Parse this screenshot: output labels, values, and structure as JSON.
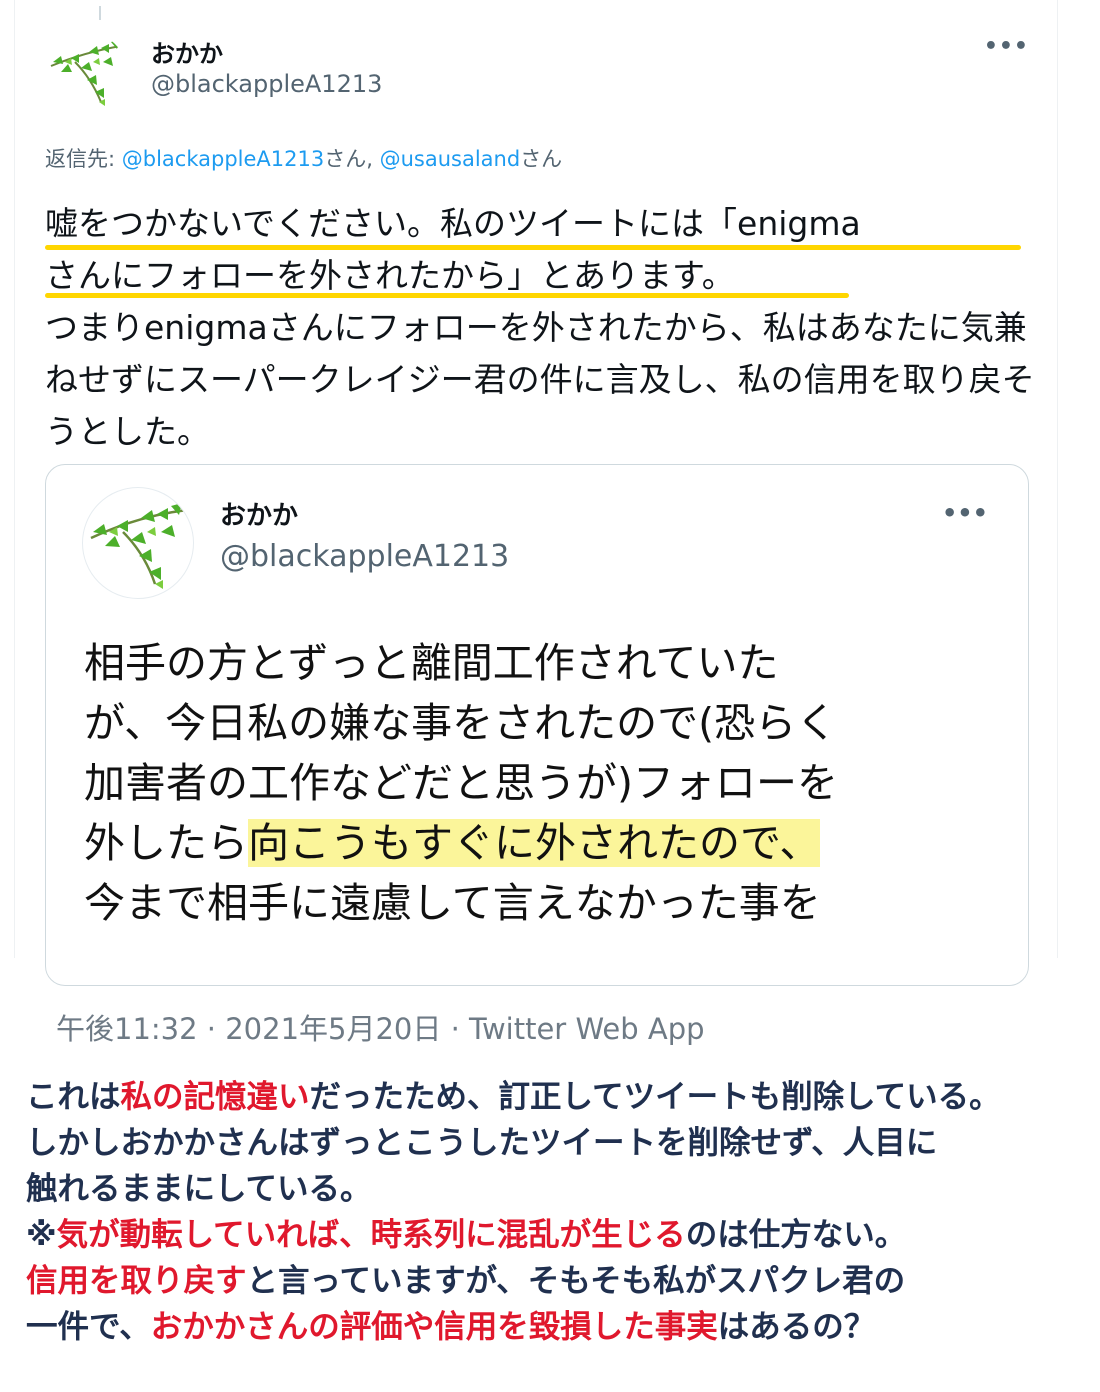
{
  "tweet": {
    "author_name": "おかか",
    "author_handle": "@blackappleA1213",
    "reply_prefix": "返信先: ",
    "reply_mention_1": "@blackappleA1213",
    "reply_suffix_1": "さん, ",
    "reply_mention_2": "@usausaland",
    "reply_suffix_2": "さん",
    "body_underlined_1": "嘘をつかないでください。私のツイートには「enigma",
    "body_underlined_2": "さんにフォローを外されたから」とあります。",
    "body_rest": "つまりenigmaさんにフォローを外されたから、私はあなたに気兼ねせずにスーパークレイジー君の件に言及し、私の信用を取り戻そうとした。",
    "timestamp": "午後11:32 · 2021年5月20日 · Twitter Web App",
    "more_icon": "more-horizontal-icon"
  },
  "quoted": {
    "author_name": "おかか",
    "author_handle": "@blackappleA1213",
    "line1": "相手の方とずっと離間工作されていた",
    "line2": "が、今日私の嫌な事をされたので(恐らく",
    "line3": "加害者の工作などだと思うが)フォローを",
    "line4_plain": "外したら",
    "line4_highlight": "向こうもすぐに外されたので、",
    "line5": "今まで相手に遠慮して言えなかった事を"
  },
  "caption": {
    "p1a": "これは",
    "p1b": "私の記憶違い",
    "p1c": "だったため、訂正してツイートも削除している。",
    "p2": "しかしおかかさんはずっとこうしたツイートを削除せず、人目に",
    "p3": "触れるままにしている。",
    "p4a": "※",
    "p4b": "気が動転していれば、時系列に混乱が生じる",
    "p4c": "のは仕方ない。",
    "p5a": "信用を取り戻す",
    "p5b": "と言っていますが、そもそも私がスパクレ君の",
    "p6a": "一件で、",
    "p6b": "おかかさんの評価や信用を毀損した事実",
    "p6c": "はあるの？"
  },
  "colors": {
    "mention": "#1d9bf0",
    "underline": "#ffd600",
    "highlight": "#fbf59a",
    "caption_red": "#e0182d",
    "caption_navy": "#20304f"
  }
}
